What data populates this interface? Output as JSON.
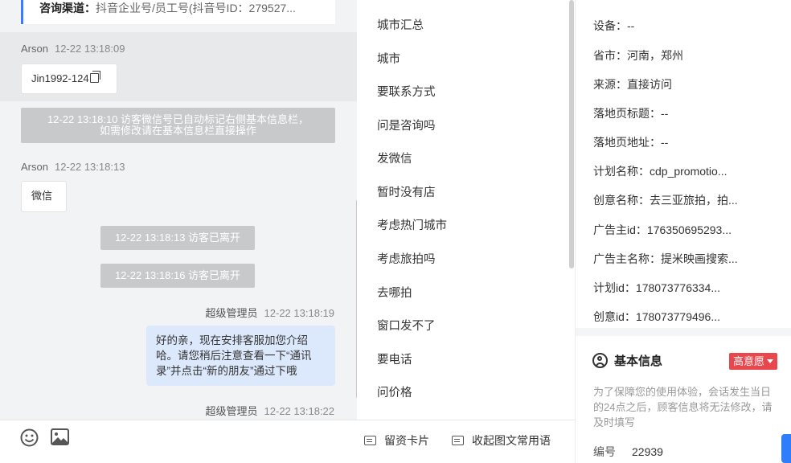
{
  "chat": {
    "info_card": {
      "label": "咨询渠道：",
      "value": "抖音企业号/员工号(抖音号ID：279527..."
    },
    "messages": [
      {
        "name": "Arson",
        "time": "12-22 13:18:09",
        "text": "Jin1992-124"
      },
      {
        "system": "12-22 13:18:10 访客微信号已自动标记右侧基本信息栏，",
        "system2": "如需修改请在基本信息栏直接操作"
      },
      {
        "name": "Arson",
        "time": "12-22 13:18:13",
        "text": "微信"
      },
      {
        "system": "12-22 13:18:13 访客已离开"
      },
      {
        "system": "12-22 13:18:16 访客已离开"
      },
      {
        "name": "超级管理员",
        "time": "12-22 13:18:19",
        "text": "好的亲，现在安排客服加您介绍哈。请您稍后注意查看一下“通讯录”并点击“新的朋友”通过下哦"
      },
      {
        "name": "超级管理员",
        "time": "12-22 13:18:22"
      }
    ]
  },
  "toolbar": {
    "emoji_icon": "emoji-icon",
    "image_icon": "image-icon",
    "lead_card": "留资卡片",
    "collapse_phrases": "收起图文常用语"
  },
  "phrases": [
    "城市汇总",
    "城市",
    "要联系方式",
    "问是咨询吗",
    "发微信",
    "暂时没有店",
    "考虑热门城市",
    "考虑旅拍吗",
    "去哪拍",
    "窗口发不了",
    "要电话",
    "问价格"
  ],
  "panel": {
    "fields": [
      {
        "label": "设备：",
        "value": "--"
      },
      {
        "label": "省市：",
        "value": "河南，郑州"
      },
      {
        "label": "来源：",
        "value": "直接访问"
      },
      {
        "label": "落地页标题：",
        "value": "--"
      },
      {
        "label": "落地页地址：",
        "value": "--"
      },
      {
        "label": "计划名称：",
        "value": "cdp_promotio..."
      },
      {
        "label": "创意名称：",
        "value": "去三亚旅拍，拍..."
      },
      {
        "label": "广告主id：",
        "value": "176350695293..."
      },
      {
        "label": "广告主名称：",
        "value": "提米映画搜索..."
      },
      {
        "label": "计划id：",
        "value": "178073776334..."
      },
      {
        "label": "创意id：",
        "value": "178073779496..."
      }
    ],
    "basic_info_title": "基本信息",
    "intent_badge": "高意愿",
    "notice": "为了保障您的使用体验，会话发生当日的24点之后，顾客信息将无法修改，请及时填写",
    "id_label": "编号",
    "id_value": "22939"
  }
}
